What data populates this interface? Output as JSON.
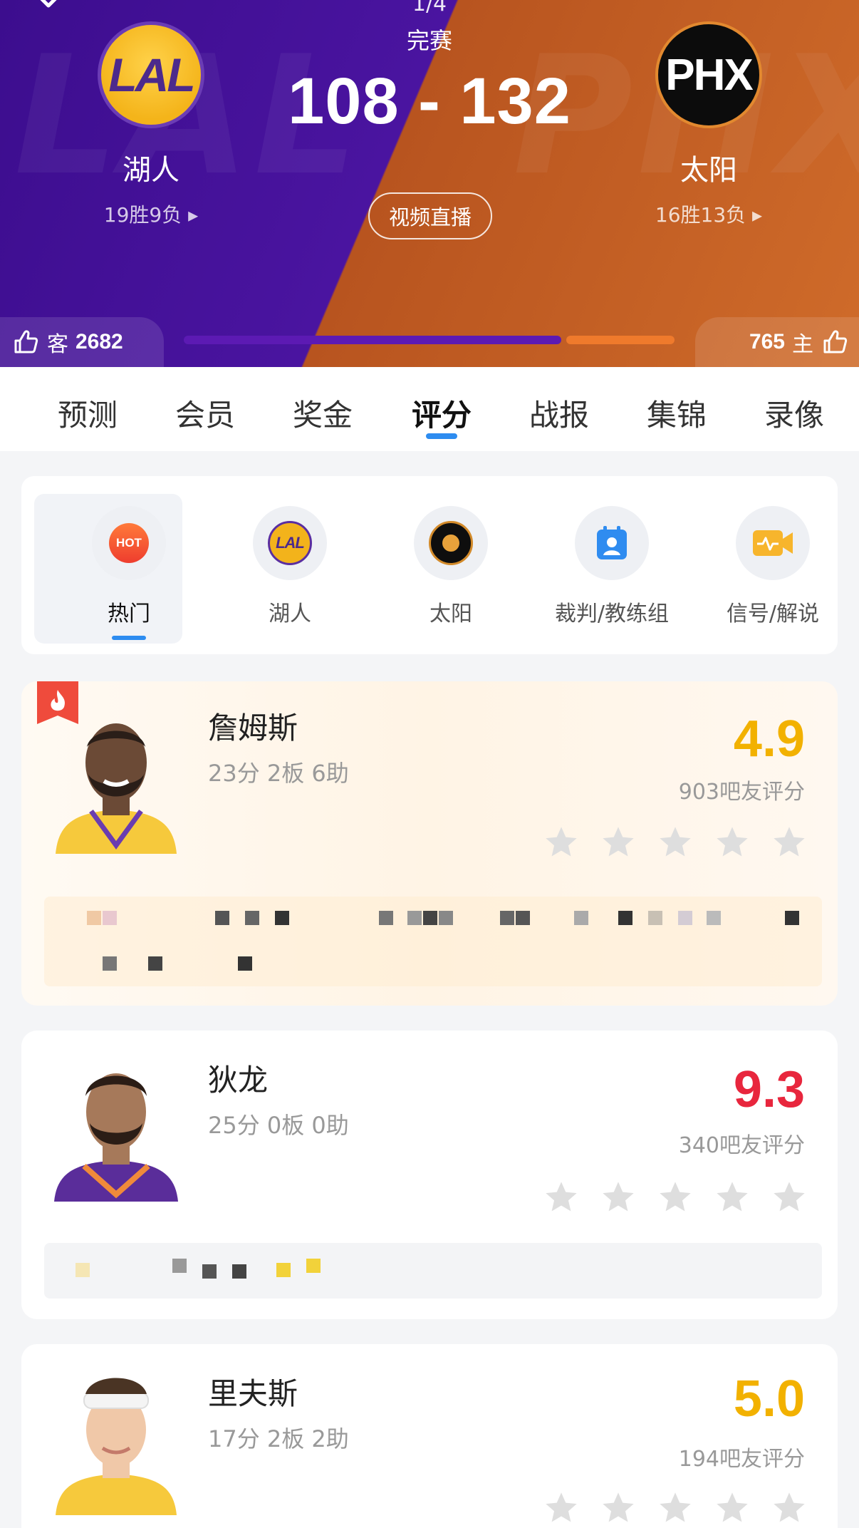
{
  "header": {
    "period": "1/4",
    "status": "完赛",
    "score": "108 - 132",
    "live_button": "视频直播",
    "away": {
      "abbr": "LAL",
      "name": "湖人",
      "record": "19胜9负 ▸",
      "side_label": "客",
      "likes": "2682"
    },
    "home": {
      "abbr": "PHX",
      "name": "太阳",
      "record": "16胜13负 ▸",
      "side_label": "主",
      "likes": "765"
    },
    "like_share_away": 0.78
  },
  "tabs": [
    "预测",
    "会员",
    "奖金",
    "评分",
    "战报",
    "集锦",
    "录像"
  ],
  "active_tab": "评分",
  "filters": [
    {
      "label": "热门",
      "icon": "hot-icon",
      "badge": "HOT"
    },
    {
      "label": "湖人",
      "icon": "lakers-logo-icon",
      "badge": "LAL"
    },
    {
      "label": "太阳",
      "icon": "suns-logo-icon"
    },
    {
      "label": "裁判/教练组",
      "icon": "referee-badge-icon"
    },
    {
      "label": "信号/解说",
      "icon": "video-camera-icon"
    }
  ],
  "players": [
    {
      "name": "詹姆斯",
      "stats": "23分 2板 6助",
      "rating": "4.9",
      "votes": "903吧友评分",
      "rating_color": "#f2b100",
      "hot": true
    },
    {
      "name": "狄龙",
      "stats": "25分 0板 0助",
      "rating": "9.3",
      "votes": "340吧友评分",
      "rating_color": "#e8263d",
      "hot": false
    },
    {
      "name": "里夫斯",
      "stats": "17分 2板 2助",
      "rating": "5.0",
      "votes": "194吧友评分",
      "rating_color": "#f2b100",
      "hot": false
    }
  ],
  "colors": {
    "accent": "#2d8cf0",
    "lakers_purple": "#4a14a0",
    "suns_orange": "#cf6b2a"
  }
}
